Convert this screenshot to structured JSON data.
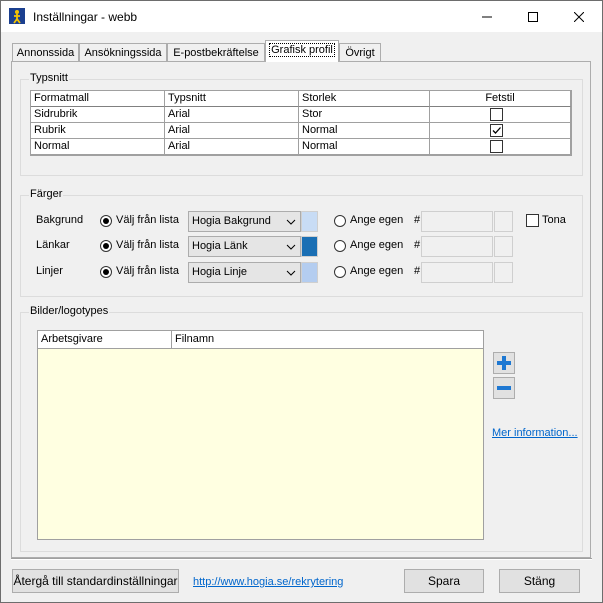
{
  "window": {
    "title": "Inställningar - webb"
  },
  "tabs": [
    {
      "label": "Annonssida"
    },
    {
      "label": "Ansökningssida"
    },
    {
      "label": "E-postbekräftelse"
    },
    {
      "label": "Grafisk profil",
      "active": true
    },
    {
      "label": "Övrigt"
    }
  ],
  "typsnitt": {
    "group_label": "Typsnitt",
    "columns": [
      "Formatmall",
      "Typsnitt",
      "Storlek",
      "Fetstil"
    ],
    "rows": [
      {
        "formatmall": "Sidrubrik",
        "typsnitt": "Arial",
        "storlek": "Stor",
        "fetstil": false
      },
      {
        "formatmall": "Rubrik",
        "typsnitt": "Arial",
        "storlek": "Normal",
        "fetstil": true
      },
      {
        "formatmall": "Normal",
        "typsnitt": "Arial",
        "storlek": "Normal",
        "fetstil": false
      }
    ]
  },
  "farger": {
    "group_label": "Färger",
    "rows": [
      {
        "label": "Bakgrund",
        "radio1": "Välj från lista",
        "combo": "Hogia Bakgrund",
        "swatch_color": "#c8dcf5",
        "radio2": "Ange egen",
        "hash": "#",
        "has_tona": true
      },
      {
        "label": "Länkar",
        "radio1": "Välj från lista",
        "combo": "Hogia Länk",
        "swatch_color": "#1a6fb4",
        "radio2": "Ange egen",
        "hash": "#",
        "has_tona": false
      },
      {
        "label": "Linjer",
        "radio1": "Välj från lista",
        "combo": "Hogia Linje",
        "swatch_color": "#b4cdf0",
        "radio2": "Ange egen",
        "hash": "#",
        "has_tona": false
      }
    ],
    "tona_label": "Tona"
  },
  "bilder": {
    "group_label": "Bilder/logotypes",
    "columns": [
      "Arbetsgivare",
      "Filnamn"
    ],
    "more_info": "Mer information..."
  },
  "footer": {
    "reset_button": "Återgå till standardinställningar",
    "link": "http://www.hogia.se/rekrytering",
    "save_button": "Spara",
    "close_button": "Stäng"
  },
  "colors": {
    "list_bg": "#ffffe1",
    "link": "#0066cc",
    "add_icon": "#1e78d2"
  }
}
